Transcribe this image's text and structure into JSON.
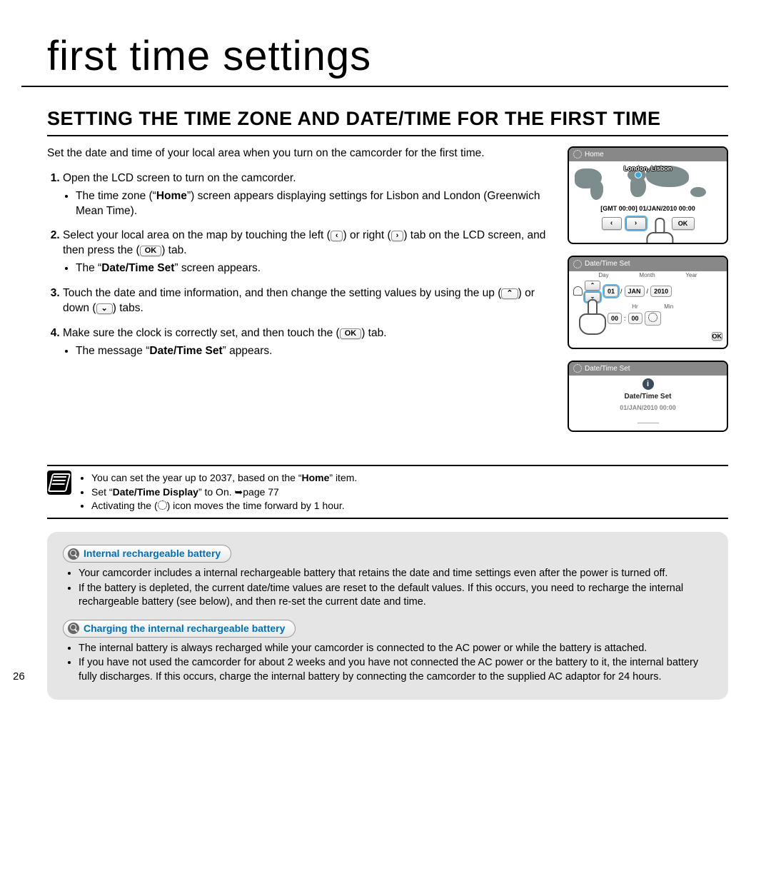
{
  "page_number": "26",
  "page_title": "first time settings",
  "section_title": "SETTING THE TIME ZONE AND DATE/TIME FOR THE FIRST TIME",
  "intro": "Set the date and time of your local area when you turn on the camcorder for the first time.",
  "steps": [
    {
      "text": "Open the LCD screen to turn on the camcorder.",
      "sub": [
        "The time zone (“Home”) screen appears displaying settings for Lisbon and London (Greenwich Mean Time)."
      ],
      "bold_in_sub": "Home"
    },
    {
      "text_pre": "Select your local area on the map by touching the left (",
      "btn1": "‹",
      "text_mid1": ") or right (",
      "btn2": "›",
      "text_mid2": ") tab on the LCD screen, and then press the (",
      "btn3": "OK",
      "text_post": ") tab.",
      "sub_pre": "The “",
      "sub_bold": "Date/Time Set",
      "sub_post": "” screen appears."
    },
    {
      "text_pre": "Touch the date and time information, and then change the setting values by using the up (",
      "btn1": "⌃",
      "text_mid1": ") or down (",
      "btn2": "⌄",
      "text_post": ") tabs."
    },
    {
      "text_pre": "Make sure the clock is correctly set, and then touch the (",
      "btn1": "OK",
      "text_post": ") tab.",
      "sub_pre": "The message “",
      "sub_bold": "Date/Time Set",
      "sub_post": "” appears."
    }
  ],
  "lcd1": {
    "header": "Home",
    "city": "London, Lisbon",
    "gmt": "[GMT 00:00] 01/JAN/2010 00:00",
    "left": "‹",
    "right": "›",
    "ok": "OK"
  },
  "lcd2": {
    "header": "Date/Time Set",
    "labels": [
      "Day",
      "Month",
      "Year",
      "Hr",
      "Min"
    ],
    "day": "01",
    "month": "JAN",
    "year": "2010",
    "hr": "00",
    "min": "00",
    "up": "⌃",
    "down": "⌄",
    "ok": "OK"
  },
  "lcd3": {
    "header": "Date/Time Set",
    "line1": "Date/Time Set",
    "line2": "01/JAN/2010 00:00"
  },
  "notes": {
    "n1_pre": "You can set the year up to 2037, based on the “",
    "n1_bold": "Home",
    "n1_post": "” item.",
    "n2_pre": "Set “",
    "n2_bold": "Date/Time Display",
    "n2_post": "” to On. ➥page 77",
    "n3": "Activating the (   ) icon moves the time forward by 1 hour."
  },
  "grey": {
    "chip1": "Internal rechargeable battery",
    "b1": "Your camcorder includes a internal rechargeable battery that retains the date and time settings even after the power is turned off.",
    "b2": "If the battery is depleted, the current date/time values are reset to the default values. If this occurs, you need to recharge the internal rechargeable battery (see below), and then re-set the current date and time.",
    "chip2": "Charging the internal rechargeable battery",
    "b3": "The internal battery is always recharged while your camcorder is connected to the AC power or while the battery is attached.",
    "b4": "If you have not used the camcorder for about 2 weeks and you have not connected the AC power or the battery to it, the internal battery fully discharges. If this occurs, charge the internal battery by connecting the camcorder to the supplied AC adaptor for 24 hours."
  }
}
